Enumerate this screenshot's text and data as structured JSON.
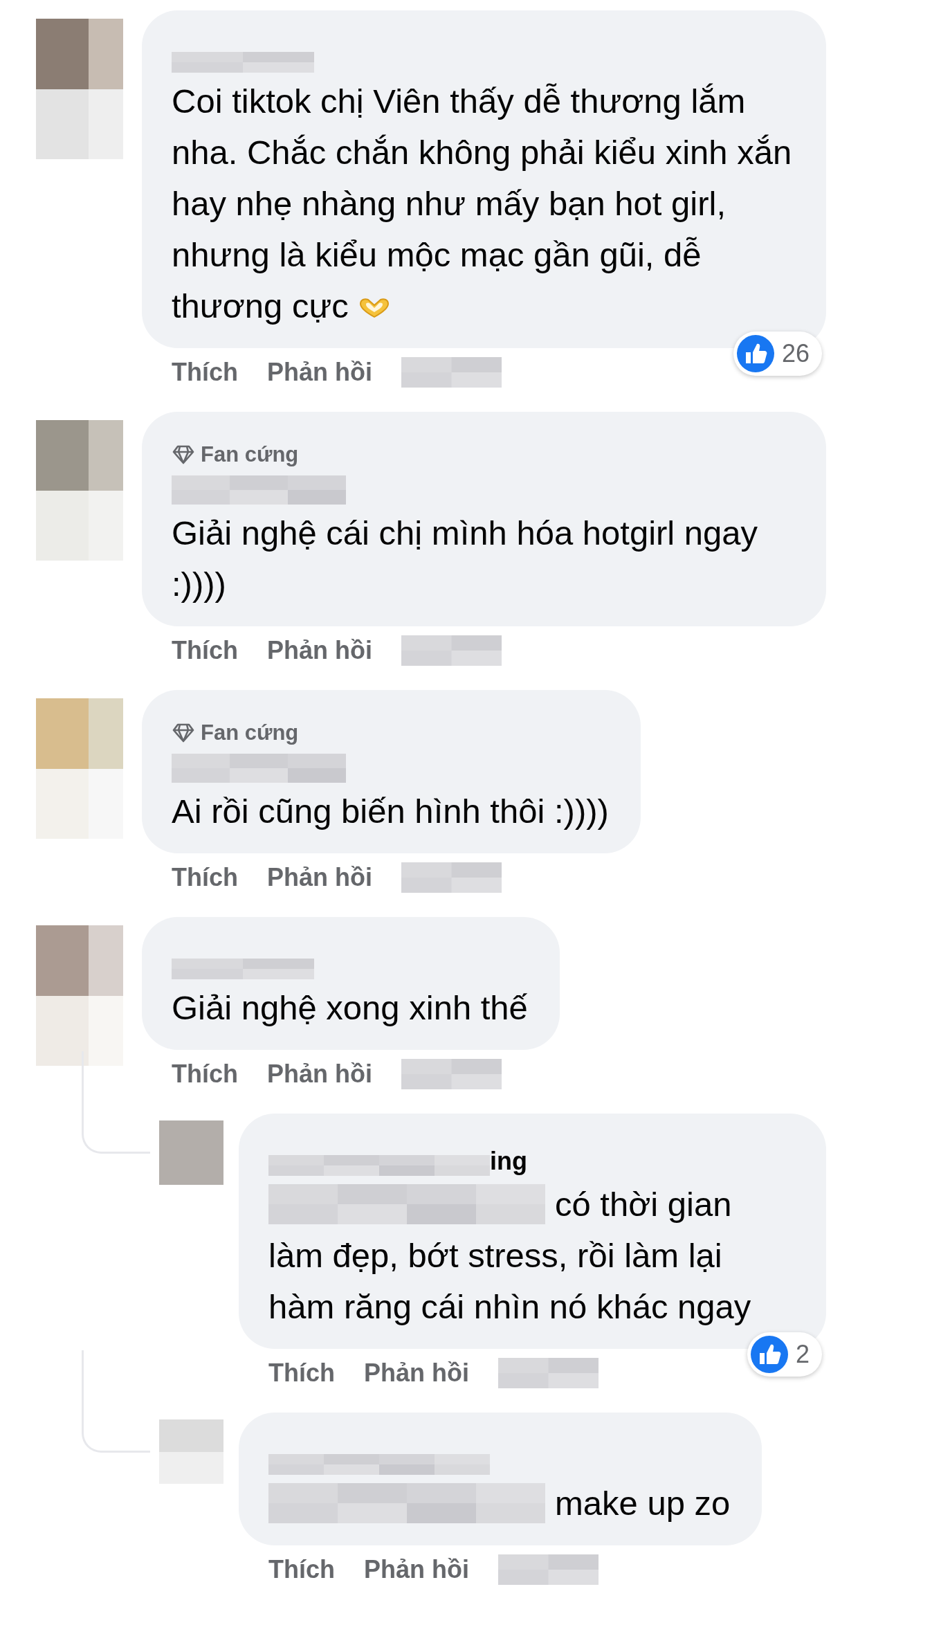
{
  "comments": [
    {
      "kind": "comment",
      "text": "Coi tiktok chị Viên thấy dễ thương lắm nha. Chắc chắn không phải kiểu xinh xắn hay nhẹ nhàng như mấy bạn hot girl, nhưng là kiểu mộc mạc gần gũi, dễ thương cực",
      "has_emoji": true,
      "reactions": "26",
      "actions": [
        "Thích",
        "Phản hồi"
      ]
    },
    {
      "kind": "comment",
      "badge": "Fan cứng",
      "text": "Giải nghệ cái chị mình hóa hotgirl ngay :))))",
      "actions": [
        "Thích",
        "Phản hồi"
      ]
    },
    {
      "kind": "comment",
      "badge": "Fan cứng",
      "text": "Ai rồi cũng biến hình thôi :))))",
      "actions": [
        "Thích",
        "Phản hồi"
      ]
    },
    {
      "kind": "comment",
      "text": "Giải nghệ xong xinh thế",
      "actions": [
        "Thích",
        "Phản hồi"
      ]
    },
    {
      "kind": "reply",
      "name_tail": "ing",
      "text": "có thời gian làm đẹp, bớt stress, rồi làm lại hàm răng cái nhìn nó khác ngay",
      "text_redacted": true,
      "reactions": "2",
      "actions": [
        "Thích",
        "Phản hồi"
      ]
    },
    {
      "kind": "reply",
      "text": "make up zo",
      "text_redacted": true,
      "actions": [
        "Thích",
        "Phản hồi"
      ]
    }
  ]
}
